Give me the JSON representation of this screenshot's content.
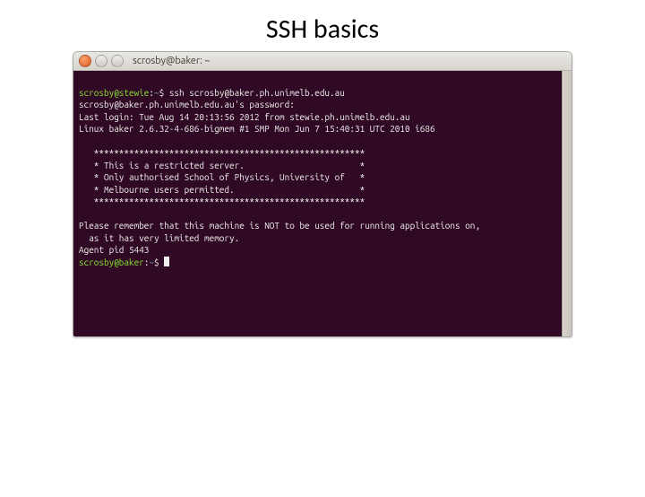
{
  "slide": {
    "title": "SSH basics"
  },
  "window": {
    "title": "scrosby@baker: ~"
  },
  "term": {
    "p1_userhost": "scrosby@stewie",
    "p1_colon": ":",
    "p1_path": "~",
    "p1_dollar_cmd": "$ ssh scrosby@baker.ph.unimelb.edu.au",
    "pwd_prompt": "scrosby@baker.ph.unimelb.edu.au's password:",
    "last_login": "Last login: Tue Aug 14 20:13:56 2012 from stewie.ph.unimelb.edu.au",
    "uname": "Linux baker 2.6.32-4-686-bigmem #1 SMP Mon Jun 7 15:40:31 UTC 2010 i686",
    "blank": "",
    "motd1": "   ******************************************************",
    "motd2": "   * This is a restricted server.                       *",
    "motd3": "   * Only authorised School of Physics, University of   *",
    "motd4": "   * Melbourne users permitted.                         *",
    "motd5": "   ******************************************************",
    "notice1": "Please remember that this machine is NOT to be used for running applications on,",
    "notice2": "  as it has very limited memory.",
    "agent": "Agent pid 5443",
    "p2_userhost": "scrosby@baker",
    "p2_colon": ":",
    "p2_path": "~",
    "p2_dollar": "$ "
  }
}
